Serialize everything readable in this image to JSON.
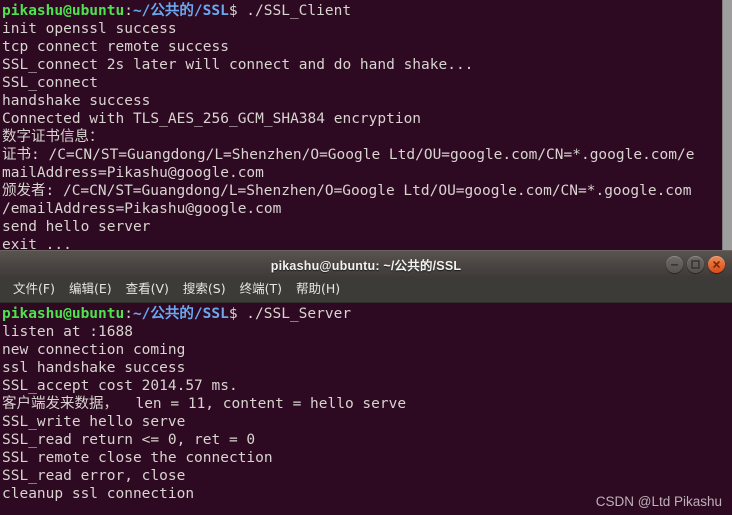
{
  "colors": {
    "terminal_background": "#2d0922",
    "foreground": "#d8d4d0",
    "prompt_user_host": "#4ee24e",
    "prompt_path": "#6aa8ef",
    "titlebar": "#4b4643",
    "menubar": "#3c3b37",
    "close_button": "#dc4a17",
    "scrollbar": "#9e9e9e"
  },
  "client_terminal": {
    "name": "SSL client terminal",
    "prompt": {
      "user_host": "pikashu@ubuntu",
      "separator": ":",
      "path": "~/公共的/SSL",
      "sigil": "$",
      "command": " ./SSL_Client"
    },
    "output_lines": [
      "init openssl success",
      "tcp connect remote success",
      "SSL_connect 2s later will connect and do hand shake...",
      "SSL_connect",
      "handshake success",
      "Connected with TLS_AES_256_GCM_SHA384 encryption",
      "数字证书信息：",
      "证书: /C=CN/ST=Guangdong/L=Shenzhen/O=Google Ltd/OU=google.com/CN=*.google.com/e",
      "mailAddress=Pikashu@google.com",
      "颁发者: /C=CN/ST=Guangdong/L=Shenzhen/O=Google Ltd/OU=google.com/CN=*.google.com",
      "/emailAddress=Pikashu@google.com",
      "send hello server",
      "exit ..."
    ],
    "scrollbar": "vertical-scrollbar"
  },
  "server_window": {
    "titlebar": {
      "title": "pikashu@ubuntu: ~/公共的/SSL",
      "buttons": [
        {
          "name": "minimize-button",
          "icon": "minimize-icon"
        },
        {
          "name": "maximize-button",
          "icon": "maximize-icon"
        },
        {
          "name": "close-button",
          "icon": "close-icon"
        }
      ]
    },
    "menubar": [
      {
        "name": "menu-file",
        "label": "文件(F)"
      },
      {
        "name": "menu-edit",
        "label": "编辑(E)"
      },
      {
        "name": "menu-view",
        "label": "查看(V)"
      },
      {
        "name": "menu-search",
        "label": "搜索(S)"
      },
      {
        "name": "menu-terminal",
        "label": "终端(T)"
      },
      {
        "name": "menu-help",
        "label": "帮助(H)"
      }
    ],
    "terminal": {
      "name": "SSL server terminal",
      "prompt": {
        "user_host": "pikashu@ubuntu",
        "separator": ":",
        "path": "~/公共的/SSL",
        "sigil": "$",
        "command": " ./SSL_Server"
      },
      "output_lines": [
        "listen at :1688",
        "new connection coming",
        "ssl handshake success",
        "SSL_accept cost 2014.57 ms.",
        "客户端发来数据，  len = 11, content = hello serve",
        "SSL_write hello serve",
        "SSL_read return <= 0, ret = 0",
        "SSL remote close the connection",
        "SSL_read error, close",
        "cleanup ssl connection"
      ]
    }
  },
  "watermark": {
    "text": "CSDN @Ltd Pikashu"
  }
}
